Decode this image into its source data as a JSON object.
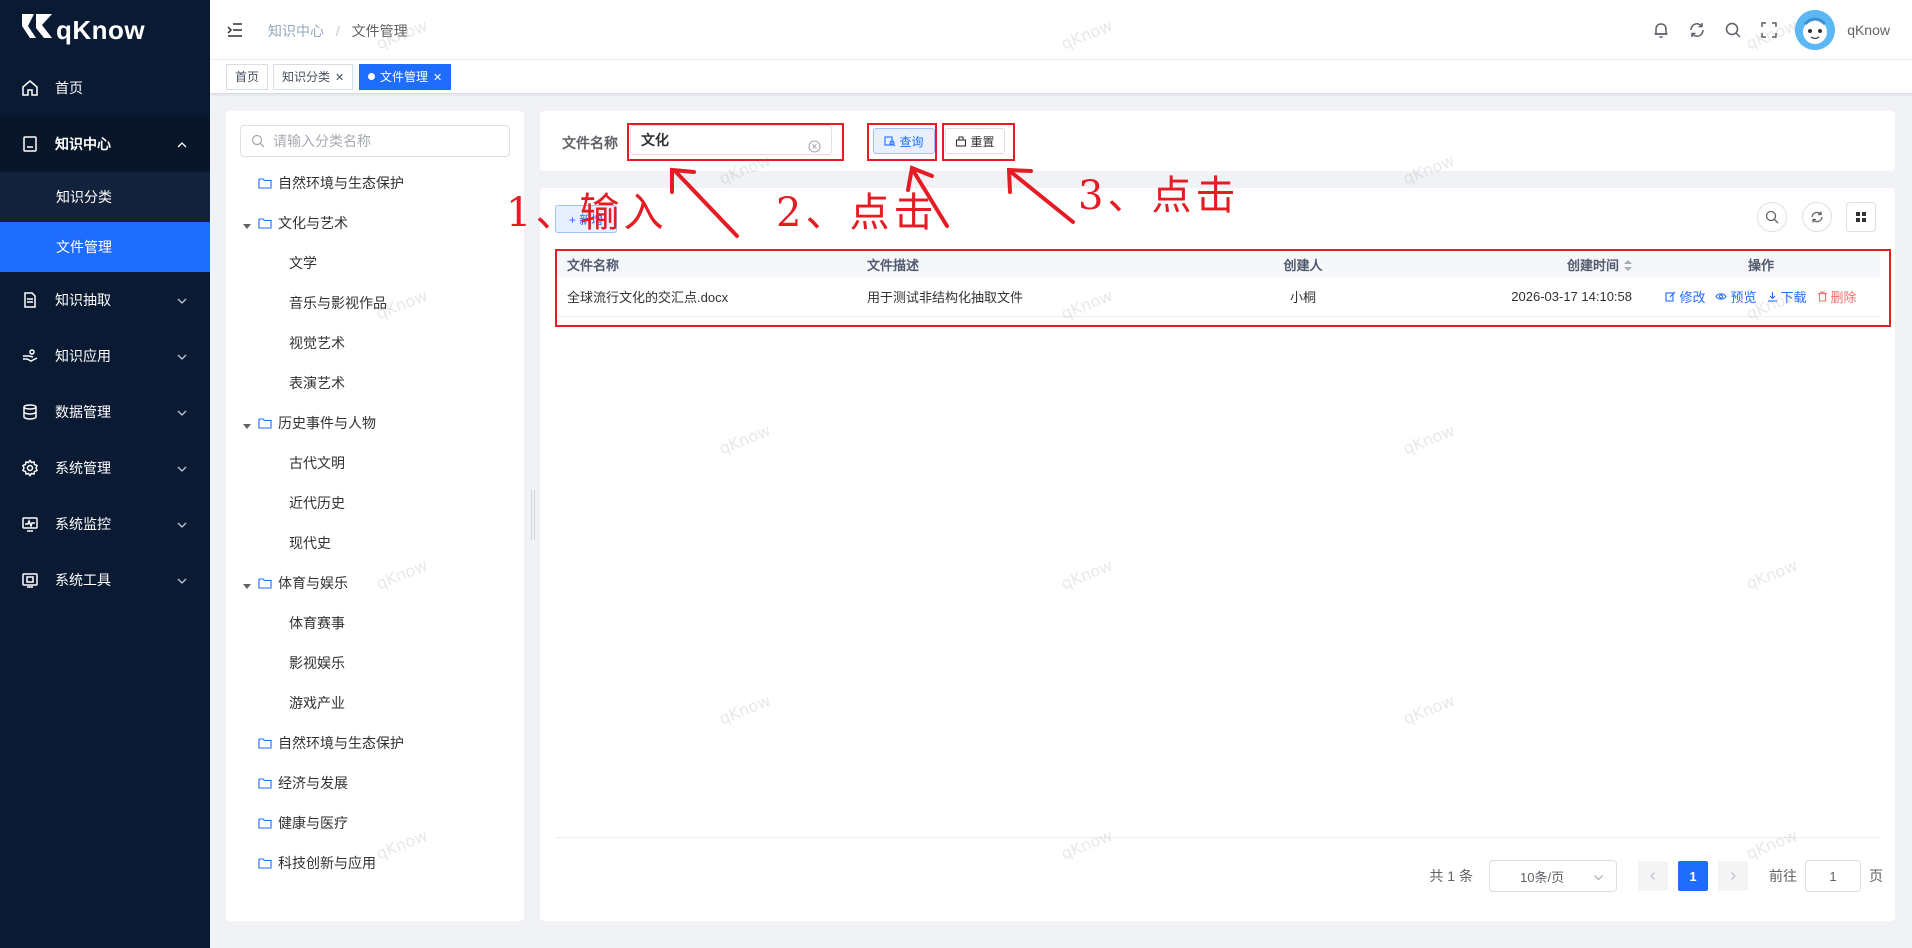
{
  "app": {
    "name": "qKnow",
    "watermark": "qKnow"
  },
  "sidebar": {
    "items": [
      {
        "label": "首页",
        "icon": "home-icon"
      },
      {
        "label": "知识中心",
        "icon": "book-icon",
        "expanded": true,
        "children": [
          {
            "label": "知识分类"
          },
          {
            "label": "文件管理",
            "active": true
          }
        ]
      },
      {
        "label": "知识抽取",
        "icon": "document-icon"
      },
      {
        "label": "知识应用",
        "icon": "hand-icon"
      },
      {
        "label": "数据管理",
        "icon": "database-icon"
      },
      {
        "label": "系统管理",
        "icon": "gear-icon"
      },
      {
        "label": "系统监控",
        "icon": "monitor-icon"
      },
      {
        "label": "系统工具",
        "icon": "toolbox-icon"
      }
    ]
  },
  "navbar": {
    "breadcrumb": [
      "知识中心",
      "文件管理"
    ],
    "username": "qKnow"
  },
  "tags": [
    {
      "label": "首页"
    },
    {
      "label": "知识分类",
      "closable": true
    },
    {
      "label": "文件管理",
      "closable": true,
      "active": true
    }
  ],
  "tree": {
    "search_placeholder": "请输入分类名称",
    "nodes": [
      {
        "label": "自然环境与生态保护",
        "level": 1,
        "expanded": false
      },
      {
        "label": "文化与艺术",
        "level": 1,
        "expanded": true
      },
      {
        "label": "文学",
        "level": 2
      },
      {
        "label": "音乐与影视作品",
        "level": 2
      },
      {
        "label": "视觉艺术",
        "level": 2
      },
      {
        "label": "表演艺术",
        "level": 2
      },
      {
        "label": "历史事件与人物",
        "level": 1,
        "expanded": true
      },
      {
        "label": "古代文明",
        "level": 2
      },
      {
        "label": "近代历史",
        "level": 2
      },
      {
        "label": "现代史",
        "level": 2
      },
      {
        "label": "体育与娱乐",
        "level": 1,
        "expanded": true
      },
      {
        "label": "体育赛事",
        "level": 2
      },
      {
        "label": "影视娱乐",
        "level": 2
      },
      {
        "label": "游戏产业",
        "level": 2
      },
      {
        "label": "自然环境与生态保护",
        "level": 1,
        "expanded": false
      },
      {
        "label": "经济与发展",
        "level": 1,
        "expanded": false
      },
      {
        "label": "健康与医疗",
        "level": 1,
        "expanded": false
      },
      {
        "label": "科技创新与应用",
        "level": 1,
        "expanded": false
      }
    ]
  },
  "search": {
    "label": "文件名称",
    "value": "文化",
    "query_label": "查询",
    "reset_label": "重置"
  },
  "toolbar": {
    "add_label": "+ 新增"
  },
  "table": {
    "columns": [
      "文件名称",
      "文件描述",
      "创建人",
      "创建时间",
      "操作"
    ],
    "rows": [
      {
        "name": "全球流行文化的交汇点.docx",
        "desc": "用于测试非结构化抽取文件",
        "creator": "小桐",
        "time": "2026-03-17 14:10:58"
      }
    ],
    "actions": {
      "edit": "修改",
      "preview": "预览",
      "download": "下载",
      "delete": "删除"
    }
  },
  "pagination": {
    "total": "共 1 条",
    "page_size": "10条/页",
    "current": "1",
    "goto_prefix": "前往",
    "goto_value": "1",
    "goto_suffix": "页"
  },
  "annotations": {
    "step1": "1、输入",
    "step2": "2、点击",
    "step3": "3、点击",
    "color": "#e51c23"
  },
  "colors": {
    "primary": "#1f6dff",
    "sidebar": "#0b1a33",
    "danger": "#f56c6c"
  }
}
